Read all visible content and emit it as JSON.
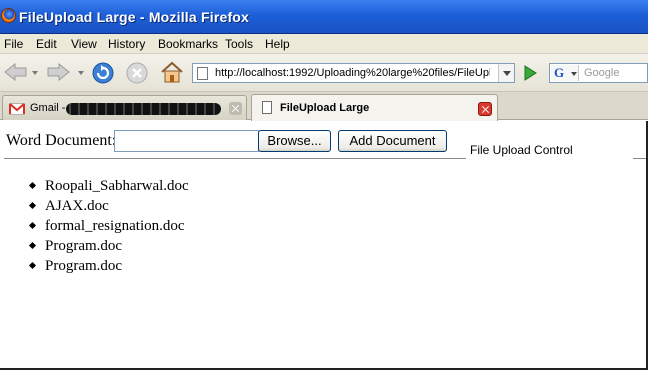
{
  "window": {
    "title": "FileUpload Large - Mozilla Firefox"
  },
  "menu": {
    "items": [
      "File",
      "Edit",
      "View",
      "History",
      "Bookmarks",
      "Tools",
      "Help"
    ]
  },
  "nav": {
    "url": "http://localhost:1992/Uploading%20large%20files/FileUpl",
    "search_placeholder": "Google",
    "search_engine_letter": "G"
  },
  "tabs": [
    {
      "label": "Gmail - ",
      "active": false,
      "icon": "gmail-icon"
    },
    {
      "label": "FileUpload Large",
      "active": true,
      "icon": "page-icon"
    }
  ],
  "page": {
    "word_label": "Word Document:",
    "file_value": "",
    "browse_label": "Browse...",
    "add_label": "Add Document",
    "legend": "File Upload Control",
    "documents": [
      "Roopali_Sabharwal.doc",
      "AJAX.doc",
      "formal_resignation.doc",
      "Program.doc",
      "Program.doc"
    ]
  },
  "colors": {
    "titlebar": "#1d5fd8",
    "menubar": "#ece9d8",
    "close_tab": "#d83a2e"
  }
}
